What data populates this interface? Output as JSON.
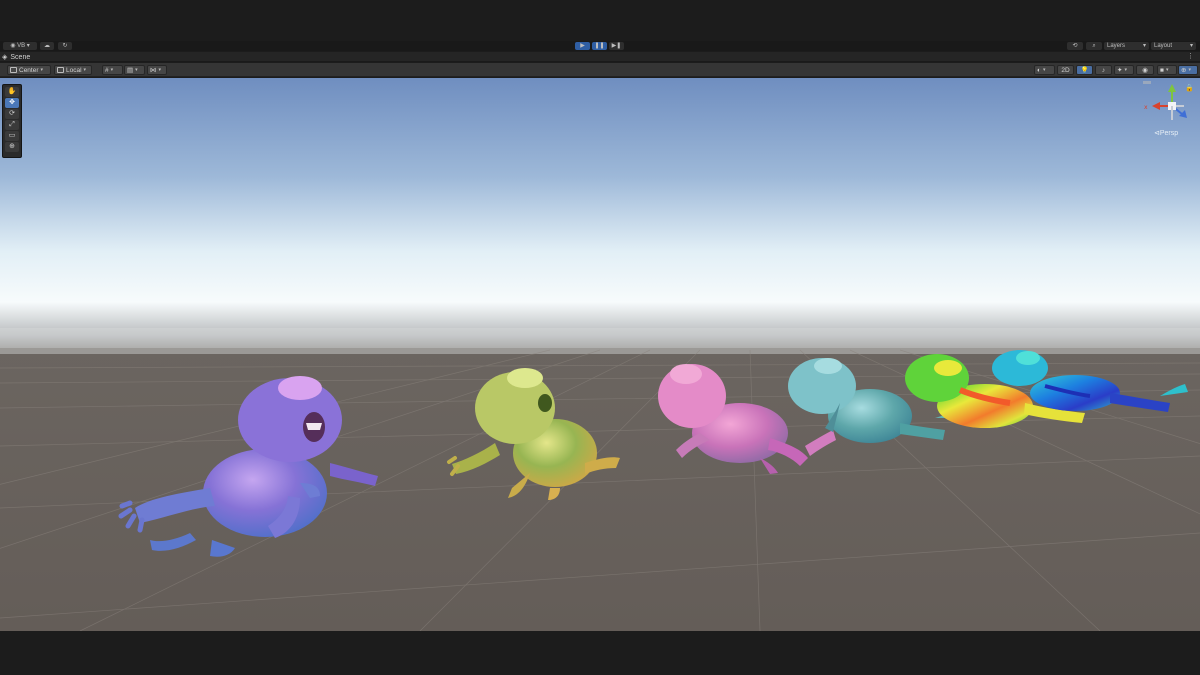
{
  "app": {
    "main_toolbar": {
      "account_label": "VB",
      "cloud_icon": "cloud-icon",
      "collab_icon": "collab-icon",
      "play_icon": "play-icon",
      "pause_icon": "pause-icon",
      "step_icon": "step-icon",
      "history_icon": "history-icon",
      "search_icon": "search-icon",
      "layers_label": "Layers",
      "layout_label": "Layout"
    },
    "scene_window": {
      "tab_label": "Scene",
      "tab_icon": "scene-icon",
      "menu_icon": "kebab-menu-icon"
    },
    "scene_toolbar": {
      "pivot_label": "Center",
      "space_label": "Local",
      "snap_icon": "grid-snap-icon",
      "increment_icon": "increment-snap-icon",
      "align_icon": "align-icon",
      "shading_icon": "shading-mode-icon",
      "mode_2d_label": "2D",
      "lighting_icon": "lighting-icon",
      "audio_icon": "audio-icon",
      "effects_icon": "effects-icon",
      "visibility_icon": "visibility-icon",
      "camera_icon": "camera-icon",
      "gizmos_icon": "gizmos-icon"
    },
    "tools": [
      {
        "name": "hand-tool",
        "icon": "hand-icon",
        "glyph": "✋",
        "selected": false
      },
      {
        "name": "move-tool",
        "icon": "move-icon",
        "glyph": "✥",
        "selected": true
      },
      {
        "name": "rotate-tool",
        "icon": "rotate-icon",
        "glyph": "⟳",
        "selected": false
      },
      {
        "name": "scale-tool",
        "icon": "scale-icon",
        "glyph": "⤢",
        "selected": false
      },
      {
        "name": "rect-tool",
        "icon": "rect-icon",
        "glyph": "▭",
        "selected": false
      },
      {
        "name": "transform-tool",
        "icon": "transform-icon",
        "glyph": "⊕",
        "selected": false
      }
    ],
    "gizmo": {
      "axis_x_label": "x",
      "persp_label": "Persp",
      "colors": {
        "x": "#d8432e",
        "y": "#7ec53e",
        "z": "#3f6fd6"
      }
    },
    "scene_objects": [
      {
        "name": "creature-purple",
        "colors": [
          "#a88be0",
          "#6a5fc8",
          "#5a79cf"
        ]
      },
      {
        "name": "creature-green",
        "colors": [
          "#c8d46a",
          "#86ad4c",
          "#d6b850"
        ]
      },
      {
        "name": "creature-pink",
        "colors": [
          "#e78fc9",
          "#c86ab8",
          "#8d7aa6"
        ]
      },
      {
        "name": "creature-teal",
        "colors": [
          "#7fc5cd",
          "#5aa6a8",
          "#4f8a9a"
        ]
      },
      {
        "name": "creature-rainbow",
        "colors": [
          "#2fc12f",
          "#f1e23a",
          "#f05a2a"
        ]
      },
      {
        "name": "creature-blue-heatmap",
        "colors": [
          "#1d8fe0",
          "#2db5c8",
          "#2444c8"
        ]
      }
    ],
    "colors": {
      "sky_top": "#6f8fc0",
      "horizon": "#f4f9fb",
      "ground": "#655f5a",
      "accent": "#4a78ba"
    }
  }
}
